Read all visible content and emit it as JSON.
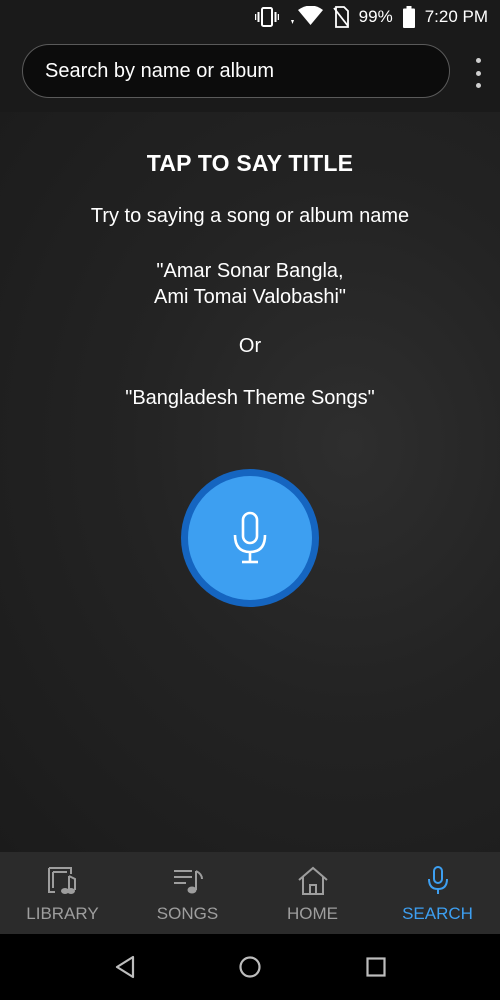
{
  "status_bar": {
    "battery": "99%",
    "time": "7:20 PM",
    "icons": [
      "vibrate-icon",
      "data-arrows-icon",
      "wifi-icon",
      "no-sim-icon",
      "battery-icon"
    ]
  },
  "search": {
    "placeholder": "Search by name or album",
    "value": ""
  },
  "voice_prompt": {
    "title": "TAP TO SAY TITLE",
    "hint": "Try to saying a song or album name",
    "example1_line1": "\"Amar Sonar Bangla,",
    "example1_line2": "Ami Tomai Valobashi\"",
    "or": "Or",
    "example2": "\"Bangladesh Theme Songs\""
  },
  "nav": {
    "items": [
      {
        "label": "LIBRARY",
        "icon": "library-icon"
      },
      {
        "label": "SONGS",
        "icon": "songs-icon"
      },
      {
        "label": "HOME",
        "icon": "home-icon"
      },
      {
        "label": "SEARCH",
        "icon": "microphone-icon",
        "active": true
      }
    ]
  },
  "colors": {
    "accent": "#3d9ff1",
    "accent_dark": "#1565c0",
    "background": "#1e1e1e",
    "nav_background": "#2b2b2b",
    "inactive_label": "#9e9e9e"
  }
}
